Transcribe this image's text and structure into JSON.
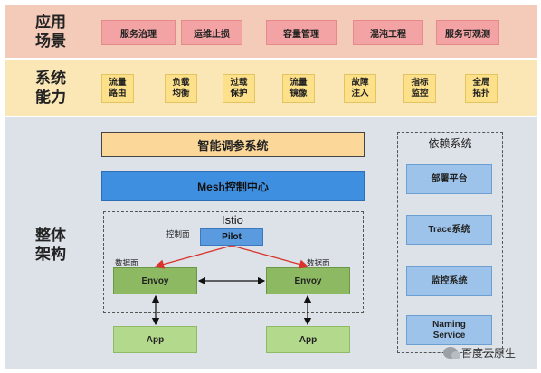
{
  "bands": {
    "app_title": "应用\n场景",
    "cap_title": "系统\n能力",
    "arch_title": "整体\n架构"
  },
  "scenarios": [
    "服务治理",
    "运维止损",
    "容量管理",
    "混沌工程",
    "服务可观测"
  ],
  "capabilities": [
    "流量\n路由",
    "负载\n均衡",
    "过载\n保护",
    "流量\n镜像",
    "故障\n注入",
    "指标\n监控",
    "全局\n拓扑"
  ],
  "architecture": {
    "tuning_system": "智能调参系统",
    "mesh_control": "Mesh控制中心",
    "istio": "Istio",
    "control_plane_label": "控制面",
    "pilot": "Pilot",
    "data_plane_label": "数据面",
    "envoy": "Envoy",
    "app": "App"
  },
  "dependencies": {
    "title": "依赖系统",
    "items": [
      "部署平台",
      "Trace系统",
      "监控系统",
      "Naming\nService"
    ]
  },
  "colors": {
    "scenario_band": "#f4cbb9",
    "capability_band": "#fbe7b5",
    "architecture_band": "#dde1e8",
    "arrow_red": "#d9342b"
  },
  "watermark": "百度云原生"
}
